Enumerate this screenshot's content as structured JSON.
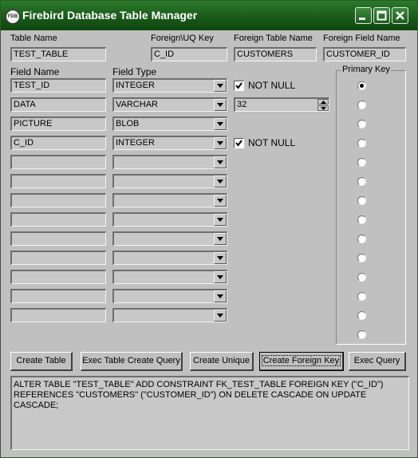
{
  "window": {
    "title": "Firebird Database Table Manager",
    "icon_text": "FDB"
  },
  "header": {
    "table_name_label": "Table Name",
    "table_name_value": "TEST_TABLE",
    "foreign_uq_key_label": "Foreign\\UQ Key",
    "foreign_uq_key_value": "C_ID",
    "foreign_table_label": "Foreign Table Name",
    "foreign_table_value": "CUSTOMERS",
    "foreign_field_label": "Foreign Field Name",
    "foreign_field_value": "CUSTOMER_ID"
  },
  "fields": {
    "field_name_label": "Field Name",
    "field_type_label": "Field Type",
    "rows": [
      {
        "name": "TEST_ID",
        "type": "INTEGER",
        "not_null": true,
        "not_null_label": "NOT NULL"
      },
      {
        "name": "DATA",
        "type": "VARCHAR",
        "size": "32"
      },
      {
        "name": "PICTURE",
        "type": "BLOB"
      },
      {
        "name": "C_ID",
        "type": "INTEGER",
        "not_null": true,
        "not_null_label": "NOT NULL"
      },
      {
        "name": "",
        "type": ""
      },
      {
        "name": "",
        "type": ""
      },
      {
        "name": "",
        "type": ""
      },
      {
        "name": "",
        "type": ""
      },
      {
        "name": "",
        "type": ""
      },
      {
        "name": "",
        "type": ""
      },
      {
        "name": "",
        "type": ""
      },
      {
        "name": "",
        "type": ""
      },
      {
        "name": "",
        "type": ""
      }
    ]
  },
  "primary_key": {
    "label": "Primary Key",
    "selected_index": 0,
    "count": 14
  },
  "buttons": {
    "create_table": "Create Table",
    "exec_table_create_query": "Exec Table Create Query",
    "create_unique": "Create Unique",
    "create_foreign_key": "Create Foreign Key",
    "exec_query": "Exec Query"
  },
  "query": {
    "text": "ALTER TABLE \"TEST_TABLE\" ADD CONSTRAINT FK_TEST_TABLE  FOREIGN KEY (\"C_ID\") REFERENCES \"CUSTOMERS\" (\"CUSTOMER_ID\") ON DELETE CASCADE ON UPDATE CASCADE;"
  },
  "colors": {
    "titlebar": "#1d5e1d",
    "face": "#c0c0c0",
    "field": "#c8c8c8"
  }
}
